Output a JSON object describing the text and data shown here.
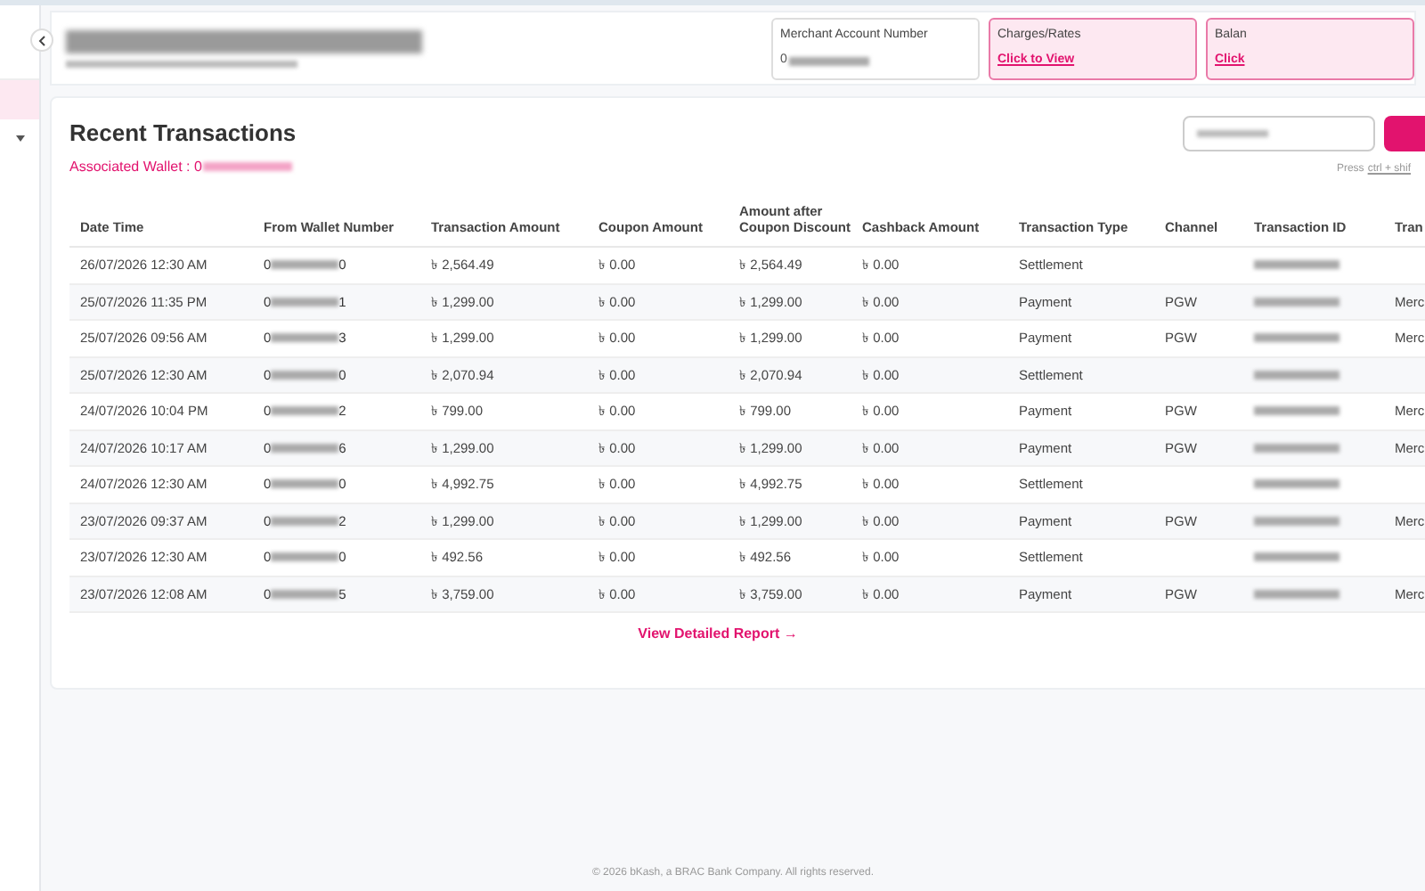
{
  "sidebar": {
    "items": [
      {
        "kind": "blank",
        "selected": true
      },
      {
        "kind": "dropdown",
        "selected": false
      }
    ]
  },
  "header": {
    "info_cards": [
      {
        "label": "Merchant Account Number",
        "value_prefix": "0",
        "highlighted": false
      },
      {
        "label": "Charges/Rates",
        "link": "Click to View",
        "highlighted": true
      },
      {
        "label": "Balan",
        "link": "Click",
        "highlighted": true
      }
    ]
  },
  "transactions": {
    "title": "Recent Transactions",
    "wallet_label": "Associated Wallet : 0",
    "hint": "Press",
    "hint_keys": "ctrl + shif",
    "columns": [
      "Date Time",
      "From Wallet Number",
      "Transaction Amount",
      "Coupon Amount",
      "Amount after Coupon Discount",
      "Cashback Amount",
      "Transaction Type",
      "Channel",
      "Transaction ID",
      "Tran"
    ],
    "rows": [
      {
        "date": "26/07/2026 12:30 AM",
        "wallet_start": "0",
        "wallet_end": "0",
        "amount": "৳ 2,564.49",
        "coupon": "৳ 0.00",
        "after": "৳ 2,564.49",
        "cashback": "৳ 0.00",
        "type": "Settlement",
        "channel": "",
        "tran": ""
      },
      {
        "date": "25/07/2026 11:35 PM",
        "wallet_start": "0",
        "wallet_end": "1",
        "amount": "৳ 1,299.00",
        "coupon": "৳ 0.00",
        "after": "৳ 1,299.00",
        "cashback": "৳ 0.00",
        "type": "Payment",
        "channel": "PGW",
        "tran": "Merc"
      },
      {
        "date": "25/07/2026 09:56 AM",
        "wallet_start": "0",
        "wallet_end": "3",
        "amount": "৳ 1,299.00",
        "coupon": "৳ 0.00",
        "after": "৳ 1,299.00",
        "cashback": "৳ 0.00",
        "type": "Payment",
        "channel": "PGW",
        "tran": "Merc"
      },
      {
        "date": "25/07/2026 12:30 AM",
        "wallet_start": "0",
        "wallet_end": "0",
        "amount": "৳ 2,070.94",
        "coupon": "৳ 0.00",
        "after": "৳ 2,070.94",
        "cashback": "৳ 0.00",
        "type": "Settlement",
        "channel": "",
        "tran": ""
      },
      {
        "date": "24/07/2026 10:04 PM",
        "wallet_start": "0",
        "wallet_end": "2",
        "amount": "৳ 799.00",
        "coupon": "৳ 0.00",
        "after": "৳ 799.00",
        "cashback": "৳ 0.00",
        "type": "Payment",
        "channel": "PGW",
        "tran": "Merc"
      },
      {
        "date": "24/07/2026 10:17 AM",
        "wallet_start": "0",
        "wallet_end": "6",
        "amount": "৳ 1,299.00",
        "coupon": "৳ 0.00",
        "after": "৳ 1,299.00",
        "cashback": "৳ 0.00",
        "type": "Payment",
        "channel": "PGW",
        "tran": "Merc"
      },
      {
        "date": "24/07/2026 12:30 AM",
        "wallet_start": "0",
        "wallet_end": "0",
        "amount": "৳ 4,992.75",
        "coupon": "৳ 0.00",
        "after": "৳ 4,992.75",
        "cashback": "৳ 0.00",
        "type": "Settlement",
        "channel": "",
        "tran": ""
      },
      {
        "date": "23/07/2026 09:37 AM",
        "wallet_start": "0",
        "wallet_end": "2",
        "amount": "৳ 1,299.00",
        "coupon": "৳ 0.00",
        "after": "৳ 1,299.00",
        "cashback": "৳ 0.00",
        "type": "Payment",
        "channel": "PGW",
        "tran": "Merc"
      },
      {
        "date": "23/07/2026 12:30 AM",
        "wallet_start": "0",
        "wallet_end": "0",
        "amount": "৳ 492.56",
        "coupon": "৳ 0.00",
        "after": "৳ 492.56",
        "cashback": "৳ 0.00",
        "type": "Settlement",
        "channel": "",
        "tran": ""
      },
      {
        "date": "23/07/2026 12:08 AM",
        "wallet_start": "0",
        "wallet_end": "5",
        "amount": "৳ 3,759.00",
        "coupon": "৳ 0.00",
        "after": "৳ 3,759.00",
        "cashback": "৳ 0.00",
        "type": "Payment",
        "channel": "PGW",
        "tran": "Merc"
      }
    ],
    "report_link": "View Detailed Report →"
  },
  "footer": "© 2026 bKash, a BRAC Bank Company. All rights reserved."
}
